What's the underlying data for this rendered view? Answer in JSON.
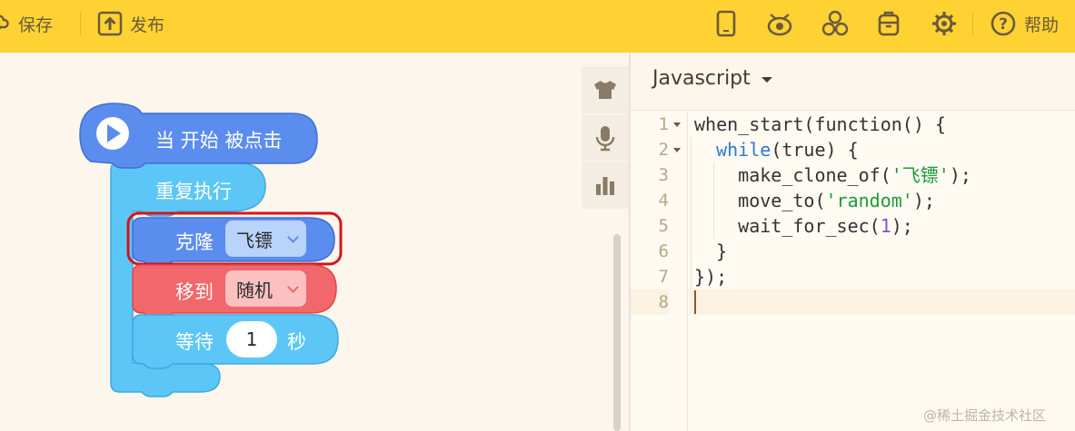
{
  "toolbar": {
    "save_label": "保存",
    "publish_label": "发布",
    "help_label": "帮助",
    "icons": [
      "save-icon",
      "publish-icon",
      "tablet-icon",
      "robot-icon",
      "extensions-icon",
      "backpack-icon",
      "settings-icon",
      "help-icon"
    ]
  },
  "rail": {
    "icons": [
      "costume-icon",
      "microphone-icon",
      "chart-icon"
    ]
  },
  "blocks": {
    "hat": "当 开始 被点击",
    "forever": "重复执行",
    "clone_label": "克隆",
    "clone_target": "飞镖",
    "move_label": "移到",
    "move_target": "随机",
    "wait_label": "等待",
    "wait_value": "1",
    "wait_unit": "秒"
  },
  "code_panel": {
    "language": "Javascript",
    "line_numbers": [
      "1",
      "2",
      "3",
      "4",
      "5",
      "6",
      "7",
      "8"
    ],
    "lines": {
      "l1": "when_start(function() {",
      "l2_kw": "while",
      "l2_rest": "(true) {",
      "l3_fn": "make_clone_of(",
      "l3_str": "'飞镖'",
      "l3_end": ");",
      "l4_fn": "move_to(",
      "l4_str": "'random'",
      "l4_end": ");",
      "l5_fn": "wait_for_sec(",
      "l5_num": "1",
      "l5_end": ");",
      "l6": "}",
      "l7": "});"
    }
  },
  "watermark": "@稀土掘金技术社区",
  "colors": {
    "toolbar": "#ffd233",
    "event_block": "#5b8def",
    "control_block": "#5cc7f7",
    "looks_block": "#5b8def",
    "motion_block": "#f2676b",
    "highlight_outline": "#d4151b"
  }
}
